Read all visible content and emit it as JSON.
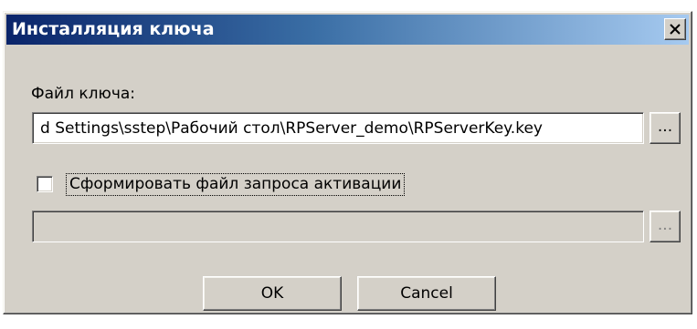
{
  "dialog": {
    "title": "Инсталляция ключа",
    "key_file_label": "Файл ключа:",
    "key_file_value": "d Settings\\sstep\\Рабочий стол\\RPServer_demo\\RPServerKey.key",
    "browse_label": "...",
    "activation_checkbox_label": "Сформировать файл запроса активации",
    "activation_checkbox_checked": false,
    "activation_file_value": "",
    "activation_browse_label": "...",
    "ok_label": "OK",
    "cancel_label": "Cancel"
  },
  "icons": {
    "close": "close-icon"
  },
  "colors": {
    "title_start": "#0a246a",
    "title_end": "#a6caf0",
    "face": "#d4d0c8"
  }
}
